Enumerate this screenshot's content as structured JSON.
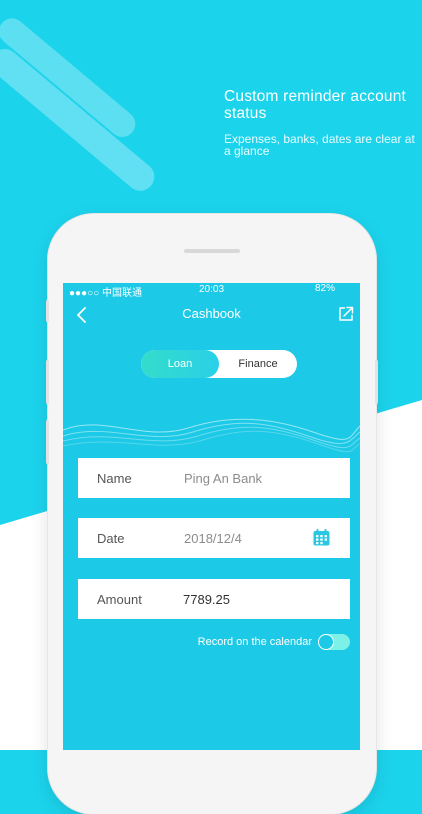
{
  "promo": {
    "headline": "Custom reminder account status",
    "subline": "Expenses, banks, dates are clear at a glance"
  },
  "status_bar": {
    "carrier": "●●●○○ 中国联通",
    "time": "20:03",
    "battery": "82%"
  },
  "nav": {
    "title": "Cashbook",
    "back_icon": "chevron-left-icon",
    "share_icon": "share-icon"
  },
  "segment": {
    "tabs": [
      "Loan",
      "Finance"
    ],
    "selected": "Loan"
  },
  "form": {
    "name_label": "Name",
    "name_value": "Ping An Bank",
    "date_label": "Date",
    "date_value": "2018/12/4",
    "amount_label": "Amount",
    "amount_value": "7789.25"
  },
  "calendar_toggle": {
    "label": "Record on the calendar",
    "on": true
  },
  "colors": {
    "background": "#1cd3ec",
    "screen": "#1cc9e6",
    "accent_gradient_start": "#33dccb",
    "accent_gradient_end": "#2ad0e8",
    "toggle_track": "#7cf1e8"
  }
}
